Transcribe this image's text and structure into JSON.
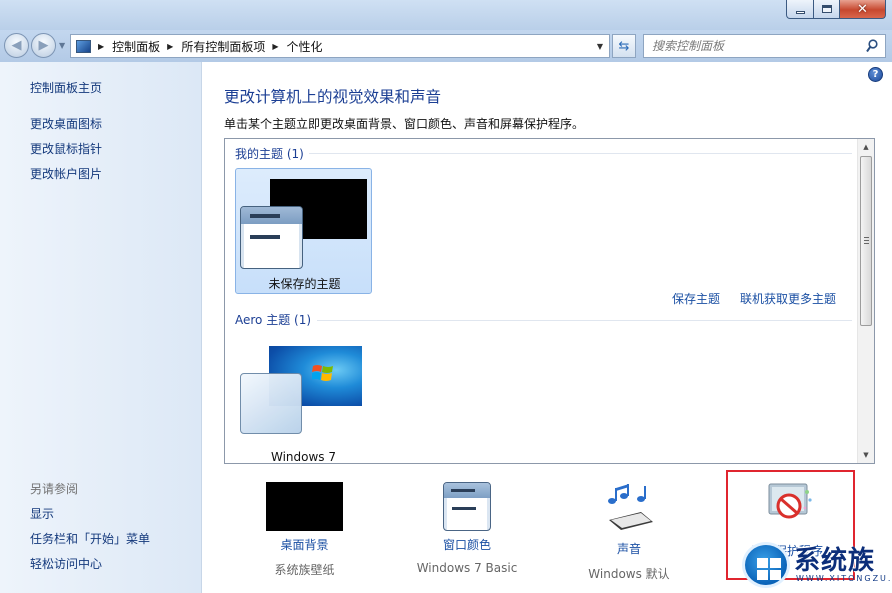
{
  "address_bar": {
    "crumbs": [
      "控制面板",
      "所有控制面板项",
      "个性化"
    ]
  },
  "search": {
    "placeholder": "搜索控制面板"
  },
  "left_pane": {
    "links": [
      "控制面板主页",
      "更改桌面图标",
      "更改鼠标指针",
      "更改帐户图片"
    ],
    "see_also_title": "另请参阅",
    "see_also_links": [
      "显示",
      "任务栏和「开始」菜单",
      "轻松访问中心"
    ]
  },
  "main": {
    "heading": "更改计算机上的视觉效果和声音",
    "subtext": "单击某个主题立即更改桌面背景、窗口颜色、声音和屏幕保护程序。",
    "my_themes_title": "我的主题 (1)",
    "unsaved_theme_label": "未保存的主题",
    "save_theme_link": "保存主题",
    "get_more_themes_link": "联机获取更多主题",
    "aero_themes_title": "Aero 主题 (1)",
    "windows7_theme_label": "Windows 7"
  },
  "bottom": {
    "items": [
      {
        "label": "桌面背景",
        "sub": "系统族壁纸"
      },
      {
        "label": "窗口颜色",
        "sub": "Windows 7 Basic"
      },
      {
        "label": "声音",
        "sub": "Windows 默认"
      },
      {
        "label": "屏幕保护程序",
        "sub": ""
      }
    ]
  },
  "watermark": {
    "text": "系统族",
    "sub": "WWW.XITONGZU.COM"
  },
  "colors": {
    "link": "#1a4fa3",
    "heading": "#1c3f94",
    "highlight_box": "#e0252f",
    "selected_tile": "#c7dffa"
  }
}
